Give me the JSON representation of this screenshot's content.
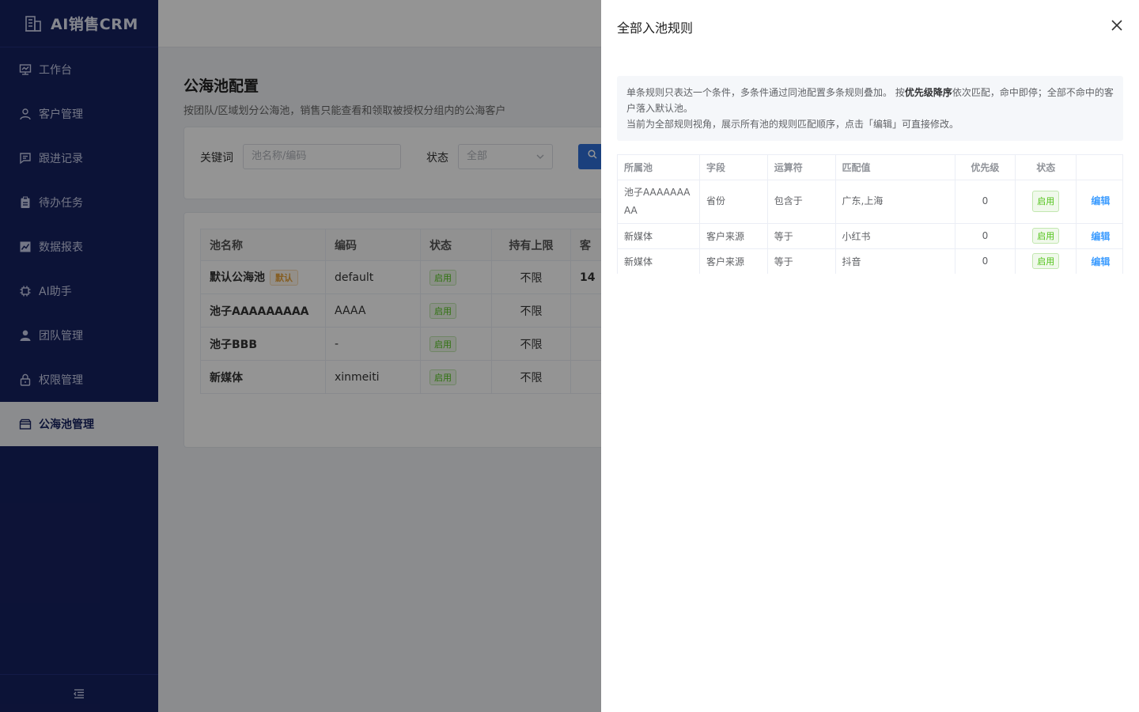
{
  "sidebar": {
    "app_title": "AI销售CRM",
    "items": [
      {
        "label": "工作台",
        "icon": "dashboard-icon"
      },
      {
        "label": "客户管理",
        "icon": "user-icon"
      },
      {
        "label": "跟进记录",
        "icon": "chat-icon"
      },
      {
        "label": "待办任务",
        "icon": "clipboard-icon"
      },
      {
        "label": "数据报表",
        "icon": "chart-icon"
      },
      {
        "label": "AI助手",
        "icon": "chip-icon"
      },
      {
        "label": "团队管理",
        "icon": "person-icon"
      },
      {
        "label": "权限管理",
        "icon": "lock-icon"
      },
      {
        "label": "公海池管理",
        "icon": "box-icon",
        "active": true
      }
    ]
  },
  "page": {
    "title": "公海池配置",
    "subtitle": "按团队/区域划分公海池，销售只能查看和领取被授权分组内的公海客户"
  },
  "filter": {
    "keyword_label": "关键词",
    "keyword_placeholder": "池名称/编码",
    "status_label": "状态",
    "status_value": "全部"
  },
  "pool_table": {
    "headers": [
      "池名称",
      "编码",
      "状态",
      "持有上限",
      "客"
    ],
    "rows": [
      {
        "name": "默认公海池",
        "tag": "默认",
        "code": "default",
        "status": "启用",
        "limit": "不限",
        "count": "14"
      },
      {
        "name": "池子AAAAAAAAA",
        "code": "AAAA",
        "status": "启用",
        "limit": "不限",
        "count": ""
      },
      {
        "name": "池子BBB",
        "code": "-",
        "status": "启用",
        "limit": "不限",
        "count": ""
      },
      {
        "name": "新媒体",
        "code": "xinmeiti",
        "status": "启用",
        "limit": "不限",
        "count": ""
      }
    ]
  },
  "drawer": {
    "title": "全部入池规则",
    "notice": {
      "line1_a": "单条规则只表达一个条件，多条件通过同池配置多条规则叠加。 按",
      "line1_bold": "优先级降序",
      "line1_b": "依次匹配，命中即停；全部不命中的客户落入默认池。",
      "line2": "当前为全部规则视角，展示所有池的规则匹配顺序，点击「编辑」可直接修改。"
    },
    "table": {
      "headers": [
        "所属池",
        "字段",
        "运算符",
        "匹配值",
        "优先级",
        "状态",
        ""
      ],
      "rows": [
        {
          "pool": "池子AAAAAAAAA",
          "field": "省份",
          "op": "包含于",
          "value": "广东,上海",
          "priority": "0",
          "status": "启用",
          "action": "编辑"
        },
        {
          "pool": "新媒体",
          "field": "客户来源",
          "op": "等于",
          "value": "小红书",
          "priority": "0",
          "status": "启用",
          "action": "编辑"
        },
        {
          "pool": "新媒体",
          "field": "客户来源",
          "op": "等于",
          "value": "抖音",
          "priority": "0",
          "status": "启用",
          "action": "编辑"
        }
      ]
    }
  },
  "colors": {
    "sidebar_bg": "#16215f",
    "primary": "#2f6fd8",
    "link": "#409eff",
    "success": "#52c41a"
  }
}
